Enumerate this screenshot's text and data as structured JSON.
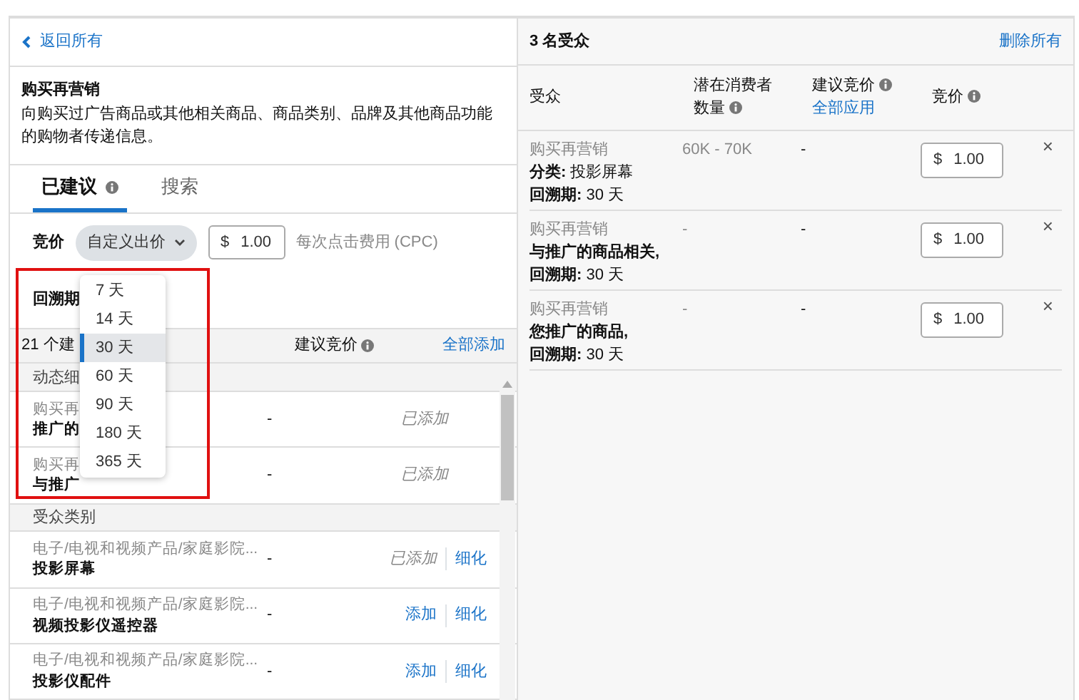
{
  "back_link": {
    "label": "返回所有"
  },
  "targeting": {
    "title": "购买再营销",
    "description": "向购买过广告商品或其他相关商品、商品类别、品牌及其他商品功能的购物者传递信息。"
  },
  "tabs": [
    {
      "label": "已建议",
      "selected": true,
      "info": true
    },
    {
      "label": "搜索",
      "selected": false,
      "info": false
    }
  ],
  "bid": {
    "label": "竞价",
    "strategy": "自定义出价",
    "currency": "$",
    "value": "1.00",
    "unit": "每次点击费用 (CPC)"
  },
  "lookback": {
    "label": "回溯期",
    "options": [
      {
        "label": "7 天",
        "selected": false
      },
      {
        "label": "14 天",
        "selected": false
      },
      {
        "label": "30 天",
        "selected": true
      },
      {
        "label": "60 天",
        "selected": false
      },
      {
        "label": "90 天",
        "selected": false
      },
      {
        "label": "180 天",
        "selected": false
      },
      {
        "label": "365 天",
        "selected": false
      }
    ]
  },
  "suggestions": {
    "count": "21 个建",
    "bid_column": "建议竞价",
    "add_all": "全部添加",
    "groups": [
      {
        "title": "动态细",
        "rows": [
          {
            "category": "购买再",
            "name": "推广的",
            "bid": "-",
            "action": "已添加",
            "added": true
          },
          {
            "category": "购买再",
            "name": "与推广",
            "bid": "-",
            "action": "已添加",
            "added": true
          }
        ]
      },
      {
        "title": "受众类别",
        "rows": [
          {
            "category": "电子/电视和视频产品/家庭影院...",
            "name": "投影屏幕",
            "bid": "-",
            "action": "已添加",
            "added": true,
            "refine": "细化"
          },
          {
            "category": "电子/电视和视频产品/家庭影院...",
            "name": "视频投影仪遥控器",
            "bid": "-",
            "action": "添加",
            "added": false,
            "refine": "细化"
          },
          {
            "category": "电子/电视和视频产品/家庭影院...",
            "name": "投影仪配件",
            "bid": "-",
            "action": "添加",
            "added": false,
            "refine": "细化"
          }
        ]
      }
    ]
  },
  "audiences": {
    "title": "3 名受众",
    "remove_all": "删除所有",
    "columns": [
      {
        "label": "受众",
        "info": false
      },
      {
        "label": "潜在消费者数量",
        "info": true
      },
      {
        "label": "建议竞价",
        "info": true,
        "link": "全部应用"
      },
      {
        "label": "竞价",
        "info": true
      }
    ],
    "rows": [
      {
        "type": "购买再营销",
        "lines": [
          "**分类:** 投影屏幕",
          "**回溯期:** 30 天"
        ],
        "reach": "60K - 70K",
        "suggested": "-",
        "currency": "$",
        "bid": "1.00",
        "remove": "×"
      },
      {
        "type": "购买再营销",
        "lines": [
          "**与推广的商品相关,**",
          "**回溯期:** 30 天"
        ],
        "reach": "-",
        "suggested": "-",
        "currency": "$",
        "bid": "1.00",
        "remove": "×"
      },
      {
        "type": "购买再营销",
        "lines": [
          "**您推广的商品,**",
          "**回溯期:** 30 天"
        ],
        "reach": "-",
        "suggested": "-",
        "currency": "$",
        "bid": "1.00",
        "remove": "×"
      }
    ]
  }
}
